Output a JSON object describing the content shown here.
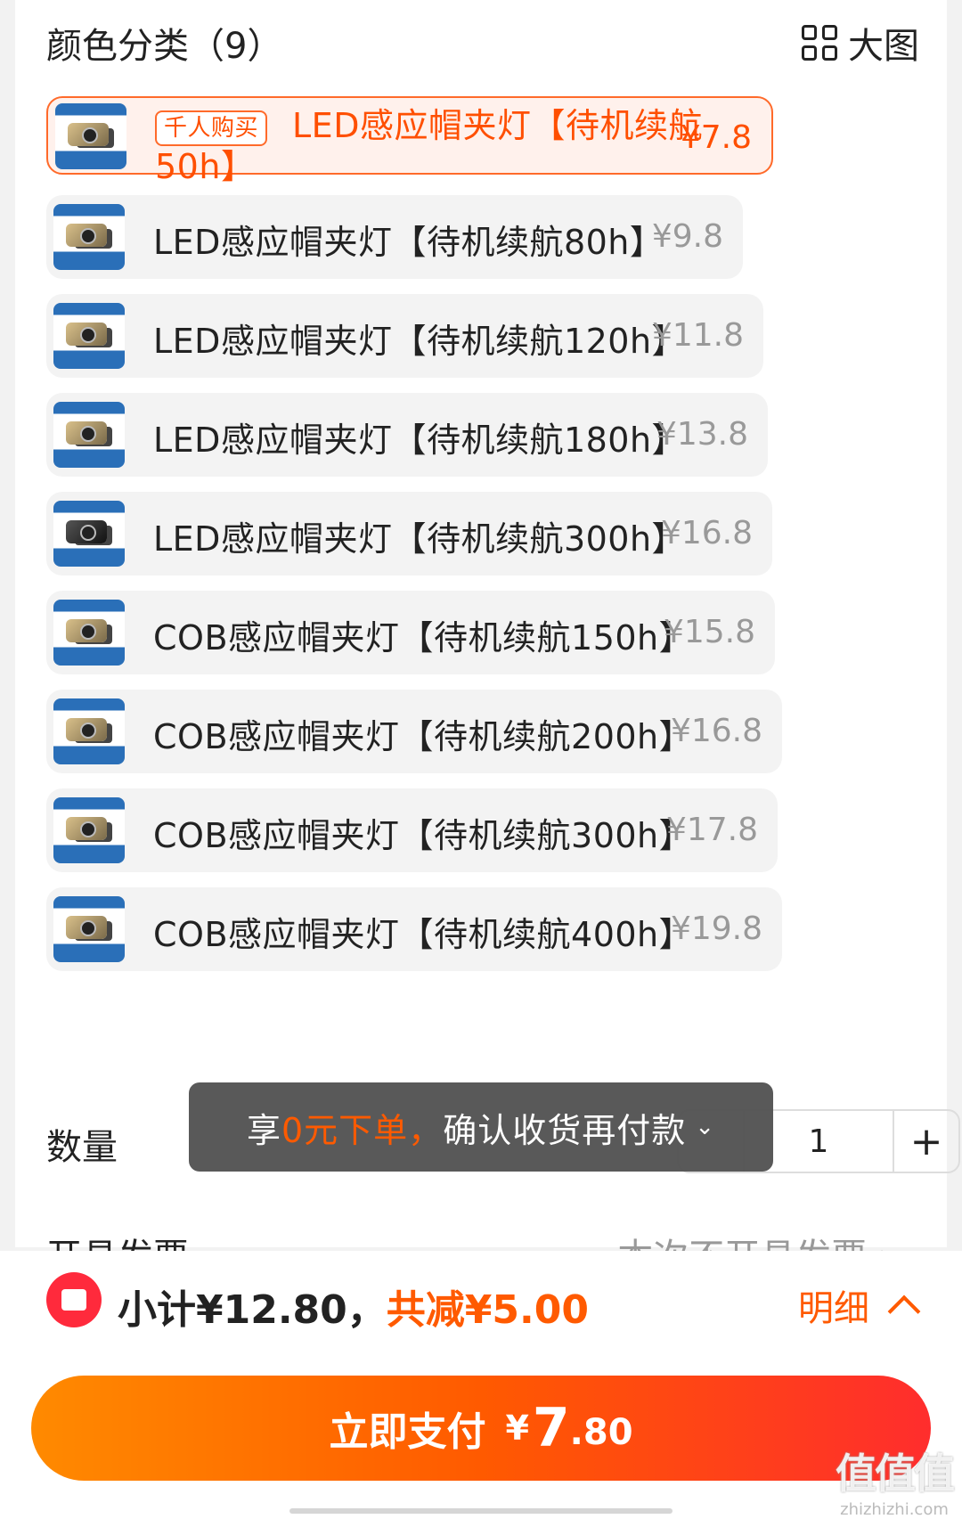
{
  "header": {
    "title": "颜色分类（9）",
    "big_view_label": "大图"
  },
  "options": [
    {
      "tag": "千人购买",
      "label": "LED感应帽夹灯【待机续航50h】",
      "price": "¥7.8",
      "selected": true
    },
    {
      "label": "LED感应帽夹灯【待机续航80h】",
      "price": "¥9.8"
    },
    {
      "label": "LED感应帽夹灯【待机续航120h】",
      "price": "¥11.8"
    },
    {
      "label": "LED感应帽夹灯【待机续航180h】",
      "price": "¥13.8"
    },
    {
      "label": "LED感应帽夹灯【待机续航300h】",
      "price": "¥16.8"
    },
    {
      "label": "COB感应帽夹灯【待机续航150h】",
      "price": "¥15.8"
    },
    {
      "label": "COB感应帽夹灯【待机续航200h】",
      "price": "¥16.8"
    },
    {
      "label": "COB感应帽夹灯【待机续航300h】",
      "price": "¥17.8"
    },
    {
      "label": "COB感应帽夹灯【待机续航400h】",
      "price": "¥19.8"
    }
  ],
  "quantity": {
    "label": "数量",
    "value": "1",
    "plus": "+"
  },
  "toast": {
    "prefix": "享",
    "highlight": "0元下单，",
    "suffix": "确认收货再付款"
  },
  "invoice": {
    "label": "开具发票",
    "value": "本次不开具发票 ›"
  },
  "summary": {
    "subtotal": "小计¥12.80，",
    "discount": "共减¥5.00",
    "detail_label": "明细"
  },
  "pay": {
    "label": "立即支付",
    "currency": "¥",
    "amount_int": "7",
    "amount_dec": ".80"
  },
  "watermark": {
    "big": "值值值",
    "small": "zhizhizhi.com"
  },
  "colors": {
    "accent": "#ff5a00",
    "selected_border": "#ff6a2a",
    "selected_bg": "#fff1ec",
    "toast_bg": "#505050"
  }
}
